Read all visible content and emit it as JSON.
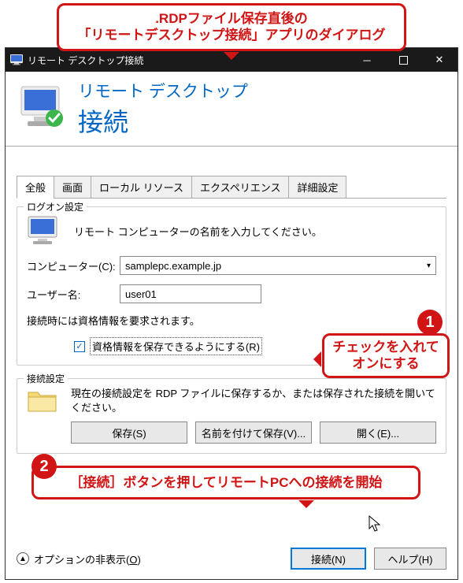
{
  "topCallout": ".RDPファイル保存直後の\n「リモートデスクトップ接続」アプリのダイアログ",
  "titlebar": {
    "title": "リモート デスクトップ接続"
  },
  "banner": {
    "line1": "リモート デスクトップ",
    "line2": "接続"
  },
  "tabs": [
    "全般",
    "画面",
    "ローカル リソース",
    "エクスペリエンス",
    "詳細設定"
  ],
  "logon": {
    "legend": "ログオン設定",
    "desc": "リモート コンピューターの名前を入力してください。",
    "computerLabel": "コンピューター(C):",
    "computerValue": "samplepc.example.jp",
    "userLabel": "ユーザー名:",
    "userValue": "user01",
    "note": "接続時には資格情報を要求されます。",
    "saveCredLabel": "資格情報を保存できるようにする(R)",
    "saveCredChecked": true
  },
  "connset": {
    "legend": "接続設定",
    "desc": "現在の接続設定を RDP ファイルに保存するか、または保存された接続を開いてください。",
    "save": "保存(S)",
    "saveAs": "名前を付けて保存(V)...",
    "open": "開く(E)..."
  },
  "bottom": {
    "toggleLabel": "オプションの非表示(O)",
    "connect": "接続(N)",
    "help": "ヘルプ(H)"
  },
  "annotations": {
    "b1": "チェックを入れて\nオンにする",
    "b2": "［接続］ボタンを押してリモートPCへの接続を開始",
    "n1": "1",
    "n2": "2"
  }
}
